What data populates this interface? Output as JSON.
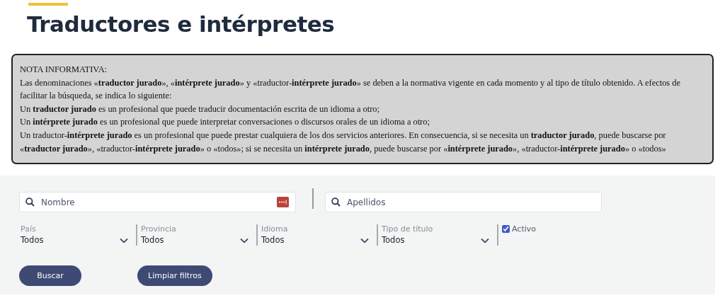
{
  "page": {
    "title": "Traductores e intérpretes"
  },
  "note": {
    "heading": "NOTA INFORMATIVA:",
    "paragraphs": [
      "Las denominaciones «**traductor jurado**», «**intérprete jurado**» y «traductor-**intérprete jurado**» se deben a la normativa vigente en cada momento y al tipo de título obtenido. A efectos de facilitar la búsqueda, se indica lo siguiente:",
      "Un **traductor jurado** es un profesional que puede traducir documentación escrita de un idioma a otro;",
      "Un **intérprete jurado** es un profesional que puede interpretar conversaciones o discursos orales de un idioma a otro;",
      "Un traductor-**intérprete jurado** es un profesional que puede prestar cualquiera de los dos servicios anteriores. En consecuencia, si se necesita un **traductor jurado**, puede buscarse por «**traductor jurado**», «traductor-**intérprete jurado**» o «todos»; si se necesita un **intérprete jurado**, puede buscarse por «**intérprete jurado**», «traductor-**intérprete jurado**» o «todos»"
    ]
  },
  "search_fields": [
    {
      "placeholder": "Nombre",
      "kind": "autofill"
    },
    {
      "placeholder": "Apellidos",
      "kind": "plain"
    }
  ],
  "dropdowns": [
    {
      "label": "País",
      "value": "Todos"
    },
    {
      "label": "Provincia",
      "value": "Todos"
    },
    {
      "label": "Idioma",
      "value": "Todos"
    },
    {
      "label": "Tipo de título",
      "value": "Todos"
    }
  ],
  "checkbox": {
    "label": "Activo",
    "checked": true
  },
  "buttons": [
    "Buscar",
    "Limpiar filtros"
  ]
}
